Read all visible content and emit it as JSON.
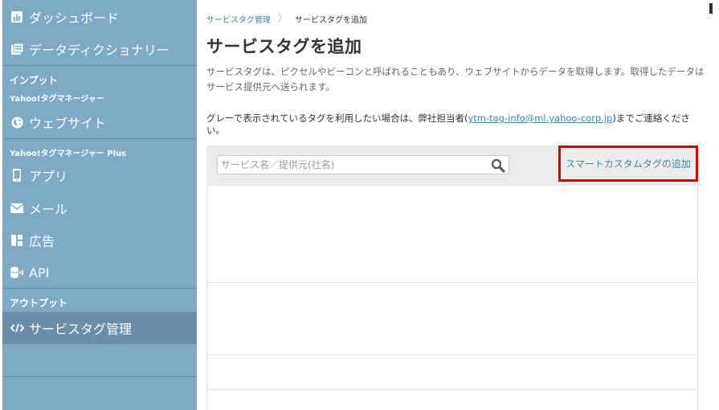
{
  "sidebar": {
    "items": {
      "dashboard": "ダッシュボード",
      "data_dictionary": "データディクショナリー",
      "website": "ウェブサイト",
      "app": "アプリ",
      "mail": "メール",
      "ads": "広告",
      "api": "API",
      "service_tag": "サービスタグ管理"
    },
    "sections": {
      "input": "インプット",
      "ytm": "Yahoo!タグマネージャー",
      "ytm_plus": "Yahoo!タグマネージャー Plus",
      "output": "アウトプット"
    }
  },
  "breadcrumb": {
    "parent": "サービスタグ管理",
    "current": "サービスタグを追加"
  },
  "main": {
    "title": "サービスタグを追加",
    "description": "サービスタグは、ピクセルやビーコンと呼ばれることもあり、ウェブサイトからデータを取得します。取得したデータはサービス提供元へ送られます。",
    "note_before": "グレーで表示されているタグを利用したい場合は、弊社担当者(",
    "note_email": "ytm-tag-info@ml.yahoo-corp.jp",
    "note_after": ")までご連絡ください。",
    "search_placeholder": "サービス名／提供元(社名)",
    "search_value": "",
    "custom_tag_button": "スマートカスタムタグの追加"
  },
  "colors": {
    "sidebar_bg": "#7faac5",
    "sidebar_active": "#6a8eaa",
    "link": "#3a85b0",
    "highlight_border": "#dc0000"
  },
  "icons": {
    "dashboard": "bar-chart-icon",
    "data_dictionary": "book-icon",
    "website": "globe-icon",
    "app": "mobile-icon",
    "mail": "envelope-icon",
    "ads": "layout-icon",
    "api": "database-arrow-icon",
    "service_tag": "code-icon",
    "search": "search-icon"
  }
}
